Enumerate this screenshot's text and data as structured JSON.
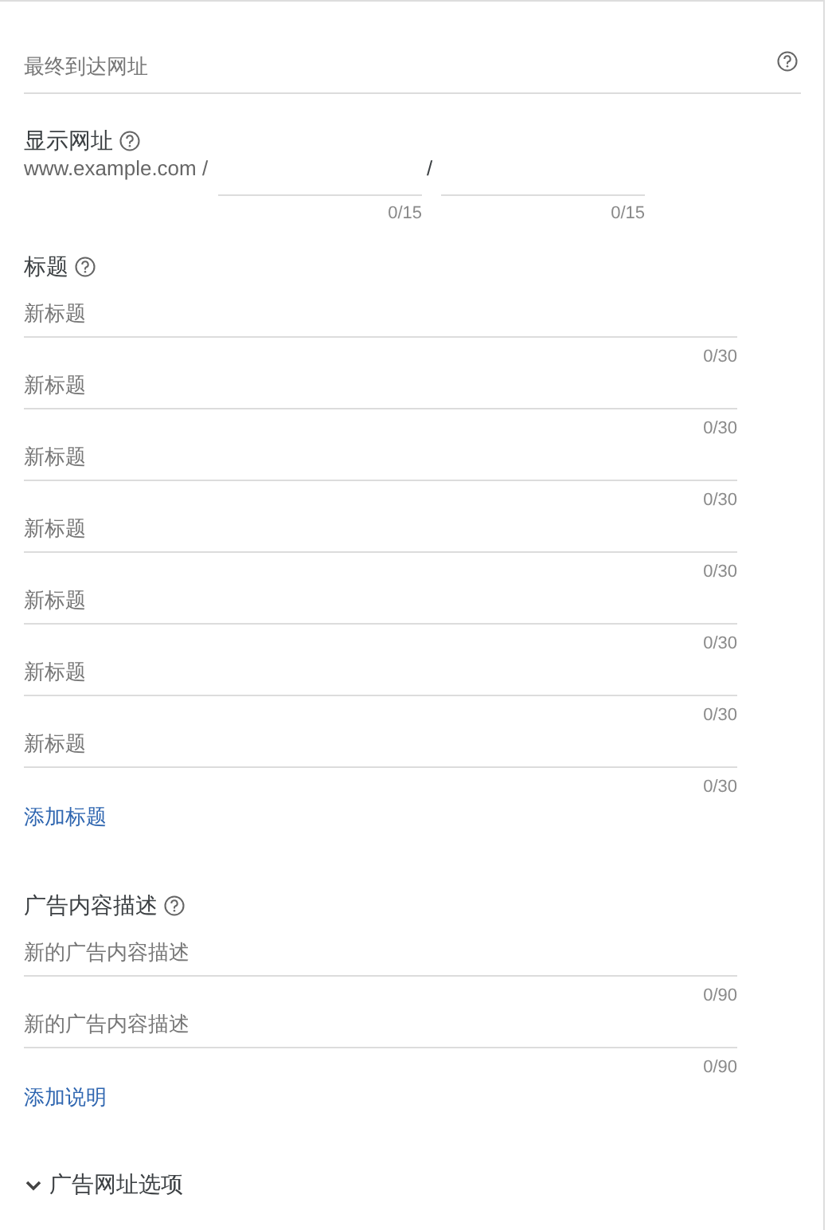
{
  "final_url": {
    "placeholder": "最终到达网址"
  },
  "display_url": {
    "label": "显示网址",
    "domain": "www.example.com /",
    "separator": "/",
    "paths": [
      {
        "counter": "0/15"
      },
      {
        "counter": "0/15"
      }
    ]
  },
  "headlines": {
    "label": "标题",
    "fields": [
      {
        "placeholder": "新标题",
        "counter": "0/30"
      },
      {
        "placeholder": "新标题",
        "counter": "0/30"
      },
      {
        "placeholder": "新标题",
        "counter": "0/30"
      },
      {
        "placeholder": "新标题",
        "counter": "0/30"
      },
      {
        "placeholder": "新标题",
        "counter": "0/30"
      },
      {
        "placeholder": "新标题",
        "counter": "0/30"
      },
      {
        "placeholder": "新标题",
        "counter": "0/30"
      }
    ],
    "add_link": "添加标题"
  },
  "descriptions": {
    "label": "广告内容描述",
    "fields": [
      {
        "placeholder": "新的广告内容描述",
        "counter": "0/90"
      },
      {
        "placeholder": "新的广告内容描述",
        "counter": "0/90"
      }
    ],
    "add_link": "添加说明"
  },
  "url_options": {
    "label": "广告网址选项",
    "expanded": false
  }
}
